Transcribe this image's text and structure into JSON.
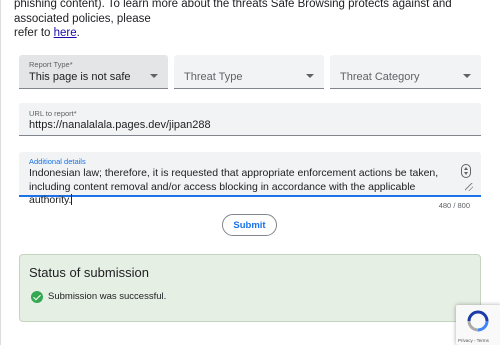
{
  "intro": {
    "line1": "phishing content). To learn more about the threats Safe Browsing protects against and associated policies, please",
    "line2_prefix": "refer to ",
    "link": "here",
    "line2_suffix": "."
  },
  "form": {
    "report_type": {
      "label": "Report Type*",
      "value": "This page is not safe"
    },
    "threat_type": {
      "placeholder": "Threat Type"
    },
    "threat_category": {
      "placeholder": "Threat Category"
    },
    "url": {
      "label": "URL to report*",
      "value": "https://nanalalala.pages.dev/jipan288"
    },
    "details": {
      "label": "Additional details",
      "value": "Indonesian law; therefore, it is requested that appropriate enforcement actions be taken, including content removal and/or access blocking in accordance with the applicable authority.",
      "counter": "480 / 800"
    },
    "submit_label": "Submit"
  },
  "status": {
    "title": "Status of submission",
    "message": "Submission was successful."
  },
  "recaptcha": {
    "links": "Privacy - Terms"
  },
  "colors": {
    "accent": "#1a73e8",
    "success": "#34a853",
    "status_bg": "#e6efe3"
  }
}
